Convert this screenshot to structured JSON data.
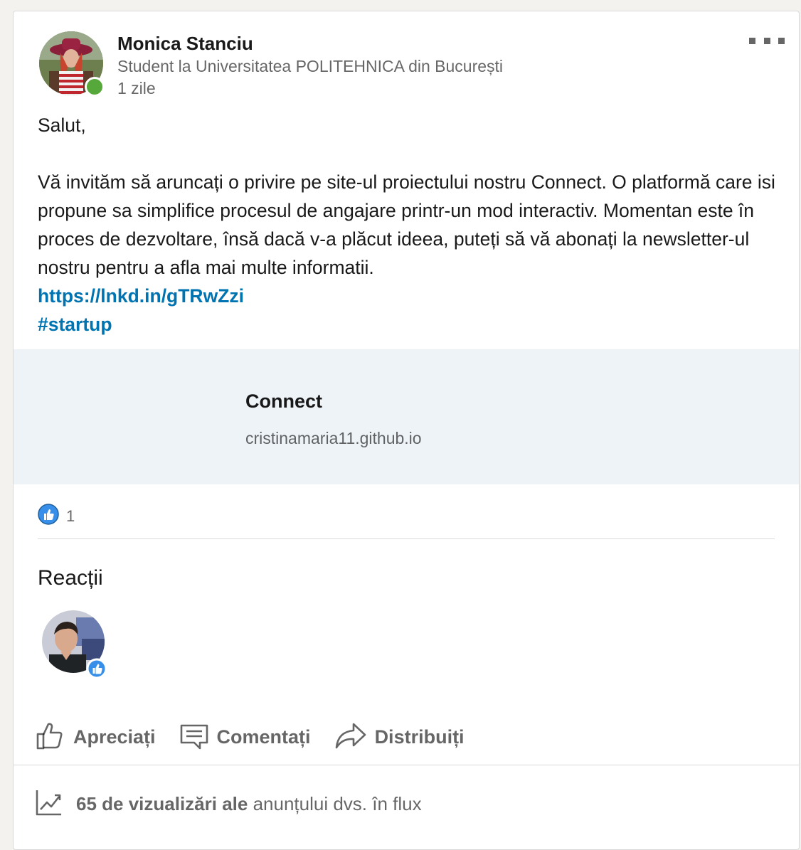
{
  "post": {
    "author": {
      "name": "Monica Stanciu",
      "headline": "Student la Universitatea POLITEHNICA din București",
      "time": "1 zile",
      "online": true
    },
    "body": {
      "greeting": "Salut,",
      "paragraph": "Vă invităm să aruncați o privire pe site-ul proiectului nostru Connect. O platformă care isi propune sa simplifice procesul de angajare printr-un mod interactiv. Momentan este în proces de dezvoltare, însă dacă v-a plăcut ideea, puteți să vă abonați la newsletter-ul nostru pentru a afla mai multe informatii.",
      "link": "https://lnkd.in/gTRwZzi",
      "hashtag": "#startup"
    },
    "preview": {
      "title": "Connect",
      "domain": "cristinamaria11.github.io"
    },
    "reactions": {
      "count": "1",
      "heading": "Reacții"
    },
    "actions": {
      "like_label": "Apreciați",
      "comment_label": "Comentați",
      "share_label": "Distribuiți"
    },
    "analytics": {
      "views_strong": "65 de vizualizări ale",
      "views_rest": " anunțului dvs. în flux"
    }
  },
  "colors": {
    "link": "#0073b1",
    "presence": "#57a83a",
    "preview_bg": "#eef3f8",
    "like_badge": "#378fe9"
  },
  "icons": [
    "more-icon",
    "like-reaction-icon",
    "thumbs-up-icon",
    "comment-icon",
    "share-icon",
    "analytics-icon"
  ]
}
